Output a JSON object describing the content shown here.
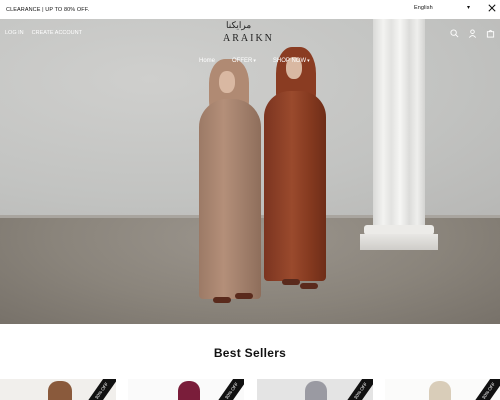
{
  "announcement": {
    "text": "CLEARANCE | UP TO 80% OFF."
  },
  "language": {
    "selected": "English"
  },
  "header": {
    "login": "LOG IN",
    "create_account": "CREATE ACCOUNT",
    "logo_script": "مرايكنا",
    "logo_word": "ARAIKN"
  },
  "menu": {
    "home": "Home",
    "offer": "OFFER",
    "shop_now": "SHOP NOW"
  },
  "icons": [
    "search-icon",
    "account-icon",
    "cart-icon",
    "twitter-icon"
  ],
  "best_sellers": {
    "title": "Best Sellers",
    "products": [
      {
        "badge": "30% OFF",
        "color": "#8a5a3c"
      },
      {
        "badge": "30% OFF",
        "color": "#7a1d3a"
      },
      {
        "badge": "30% OFF",
        "color": "#9a9aa2"
      },
      {
        "badge": "30% OFF",
        "color": "#d9cdb9"
      }
    ]
  },
  "colors": {
    "robe_left": "#a98470",
    "robe_right": "#8c3f24",
    "shoes": "#5a2a1c"
  }
}
